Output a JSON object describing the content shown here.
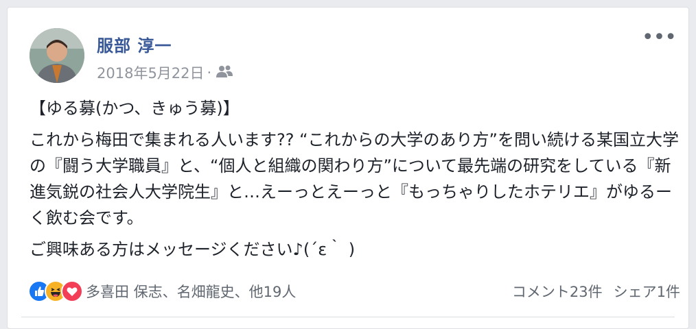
{
  "post": {
    "author": "服部 淳一",
    "date": "2018年5月22日",
    "separator": "·",
    "audience_icon": "friends-icon",
    "menu_glyph": "•••",
    "paragraphs": [
      "【ゆる募(かつ、きゅう募)】",
      "これから梅田で集まれる人います?? “これからの大学のあり方”を問い続ける某国立大学の『闘う大学職員』と、“個人と組織の関わり方”について最先端の研究をしている『新進気鋭の社会人大学院生』と…えーっとえーっと『もっちゃりしたホテリエ』がゆるーく飲む会です。",
      "ご興味ある方はメッセージください♪(´ε｀ )"
    ]
  },
  "footer": {
    "reactions": [
      "like-icon",
      "haha-icon",
      "love-icon"
    ],
    "reactors": "多喜田 保志、名畑龍史、他19人",
    "comments": "コメント23件",
    "shares": "シェア1件"
  },
  "colors": {
    "link": "#385898",
    "meta": "#90949c",
    "like": "#1877f2",
    "love": "#f33e58",
    "haha": "#f7b125"
  }
}
